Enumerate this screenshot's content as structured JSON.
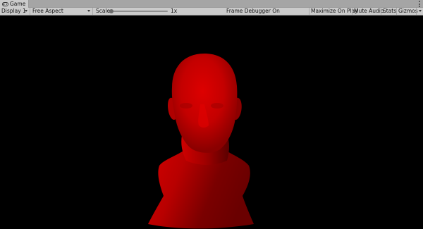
{
  "tab": {
    "label": "Game",
    "icon": "gamepad-icon",
    "menu_icon": "more-options-icon"
  },
  "toolbar": {
    "display": "Display 1",
    "aspect": "Free Aspect",
    "scale_label": "Scale",
    "scale_value": "1x",
    "frame_debugger": "Frame Debugger On",
    "maximize_on_play": "Maximize On Play",
    "mute_audio": "Mute Audio",
    "stats": "Stats",
    "gizmos": "Gizmos"
  },
  "viewport": {
    "background": "#000000",
    "object": "head-bust-model",
    "object_color": "#c80000"
  }
}
